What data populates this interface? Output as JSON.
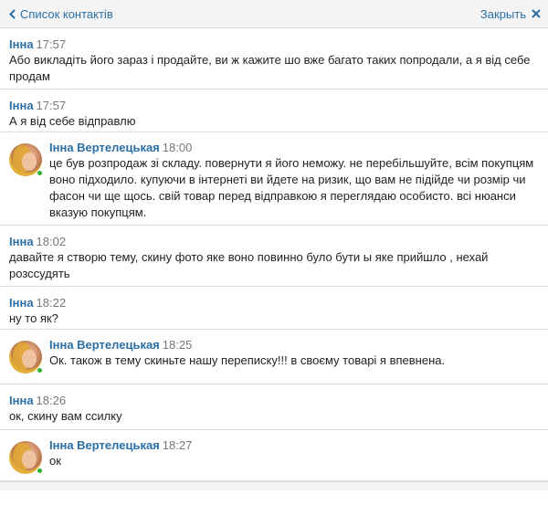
{
  "header": {
    "back_label": "Список контактів",
    "close_label": "Закрыть"
  },
  "messages": [
    {
      "author": "Інна",
      "time": "17:57",
      "text": "Або викладіть його зараз і продайте, ви ж кажите шо вже багато таких попродали, а я від себе продам"
    },
    {
      "author": "Інна",
      "time": "17:57",
      "text": "А я від себе відправлю"
    },
    {
      "author": "Інна Вертелецькая",
      "time": "18:00",
      "text": "це був розпродаж зі складу. повернути я його неможу. не перебільшуйте, всім покупцям воно підходило. купуючи в інтернеті ви йдете на ризик, що вам не підійде чи розмір чи фасон чи ще щось. свій товар перед відправкою я переглядаю особисто. всі нюанси вказую покупцям."
    },
    {
      "author": "Інна",
      "time": "18:02",
      "text": "давайте я створю тему, скину фото яке воно повинно було бути ы яке прийшло , нехай розссудять"
    },
    {
      "author": "Інна",
      "time": "18:22",
      "text": "ну то як?"
    },
    {
      "author": "Інна Вертелецькая",
      "time": "18:25",
      "text": "Ок. також в тему скиньте нашу переписку!!! в своєму товарі я впевнена."
    },
    {
      "author": "Інна",
      "time": "18:26",
      "text": "ок, скину вам ссилку"
    },
    {
      "author": "Інна Вертелецькая",
      "time": "18:27",
      "text": "ок"
    }
  ],
  "colors": {
    "link": "#2b6fa6",
    "online": "#2fae2f"
  }
}
